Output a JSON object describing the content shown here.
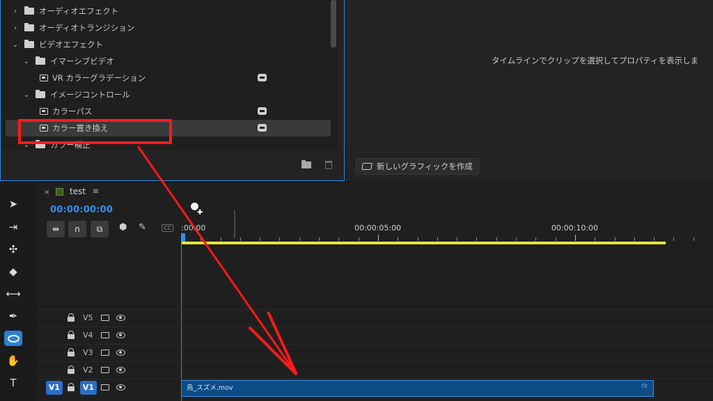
{
  "effects_panel": {
    "tree": [
      {
        "label": "オーディオエフェクト",
        "level": 0,
        "kind": "folder",
        "expanded": false
      },
      {
        "label": "オーディオトランジション",
        "level": 0,
        "kind": "folder",
        "expanded": false
      },
      {
        "label": "ビデオエフェクト",
        "level": 0,
        "kind": "folder",
        "expanded": true
      },
      {
        "label": "イマーシブビデオ",
        "level": 1,
        "kind": "folder",
        "expanded": true
      },
      {
        "label": "VR カラーグラデーション",
        "level": 2,
        "kind": "effect",
        "accelerated": true
      },
      {
        "label": "イメージコントロール",
        "level": 1,
        "kind": "folder",
        "expanded": true
      },
      {
        "label": "カラーパス",
        "level": 2,
        "kind": "effect",
        "accelerated": true
      },
      {
        "label": "カラー置き換え",
        "level": 2,
        "kind": "effect",
        "accelerated": true,
        "selected": true
      },
      {
        "label": "カラー補正",
        "level": 1,
        "kind": "folder",
        "expanded": true
      }
    ],
    "new_bin_icon": "folder-icon",
    "delete_icon": "trash-icon"
  },
  "graphics_panel": {
    "message": "タイムラインでクリップを選択してプロパティを表示しま",
    "new_graphic_label": "新しいグラフィックを作成"
  },
  "tools": [
    {
      "name": "selection-tool",
      "glyph": "➤",
      "active": false
    },
    {
      "name": "track-select-tool",
      "glyph": "⇥",
      "active": false
    },
    {
      "name": "ripple-edit-tool",
      "glyph": "✣",
      "active": false
    },
    {
      "name": "razor-tool",
      "glyph": "◆",
      "active": false
    },
    {
      "name": "slip-tool",
      "glyph": "⟷",
      "active": false
    },
    {
      "name": "pen-tool",
      "glyph": "✒",
      "active": false
    },
    {
      "name": "ellipse-tool",
      "glyph": "",
      "active": true
    },
    {
      "name": "hand-tool",
      "glyph": "✋",
      "active": false
    },
    {
      "name": "type-tool",
      "glyph": "T",
      "active": false
    }
  ],
  "timeline": {
    "sequence_name": "test",
    "timecode": "00:00:00:00",
    "ruler": {
      "labels": [
        ":00:00",
        "00:00:05:00",
        "00:00:10:00"
      ],
      "unit": "seconds",
      "range": [
        0,
        13.5
      ],
      "label_times": [
        0,
        5,
        10
      ],
      "work_area_end": 12.3
    },
    "tracks": [
      {
        "label": "V5",
        "target": false,
        "source_patch": ""
      },
      {
        "label": "V4",
        "target": false,
        "source_patch": ""
      },
      {
        "label": "V3",
        "target": false,
        "source_patch": ""
      },
      {
        "label": "V2",
        "target": false,
        "source_patch": ""
      },
      {
        "label": "V1",
        "target": true,
        "source_patch": "V1"
      }
    ],
    "clip": {
      "name": "鳥_スズメ.mov",
      "fx_badge": "fx"
    },
    "cc_label": "CC"
  },
  "colors": {
    "accent": "#2d8ceb",
    "timecode": "#2f8ff0",
    "work_area": "#e6e63a",
    "clip": "#0e4c86",
    "annotation": "#ff1a1a"
  }
}
